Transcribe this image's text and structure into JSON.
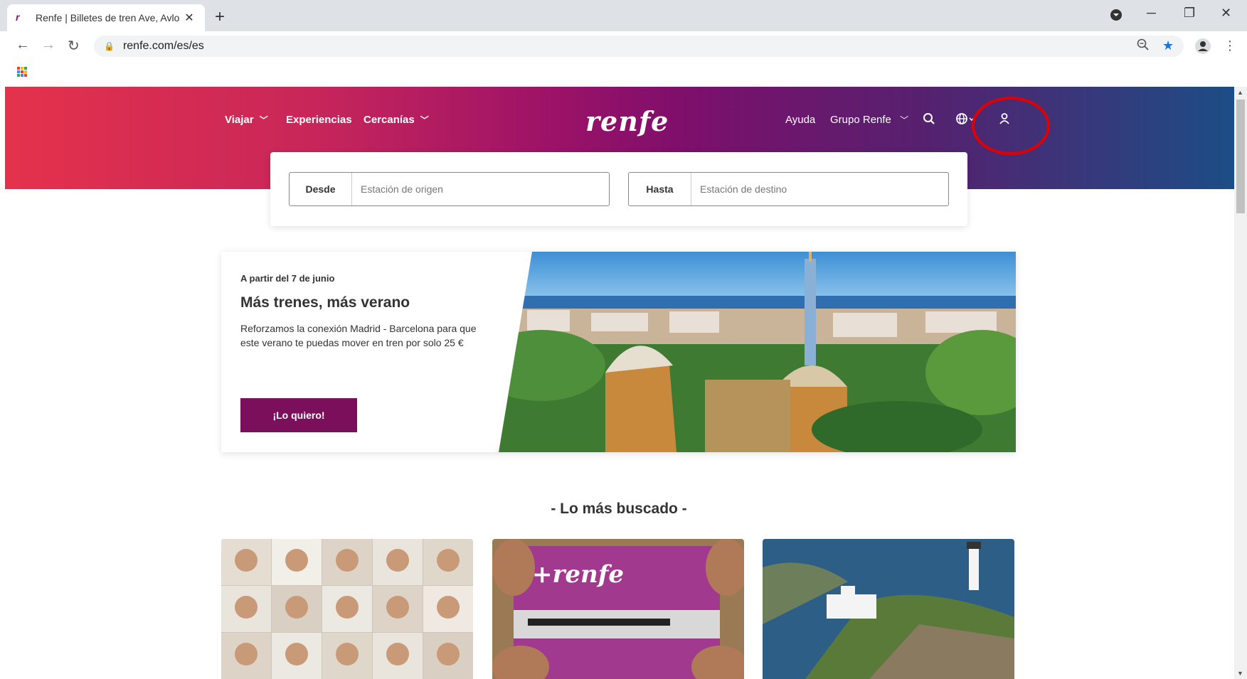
{
  "browser": {
    "tab_title": "Renfe | Billetes de tren Ave, Avlo",
    "tab_close": "✕",
    "new_tab": "+",
    "url": "renfe.com/es/es"
  },
  "header": {
    "nav_left": [
      {
        "label": "Viajar",
        "chevron": true
      },
      {
        "label": "Experiencias",
        "chevron": false
      },
      {
        "label": "Cercanías",
        "chevron": true
      }
    ],
    "logo": "renfe",
    "nav_right": [
      {
        "label": "Ayuda"
      },
      {
        "label": "Grupo Renfe"
      }
    ]
  },
  "search": {
    "from_label": "Desde",
    "from_placeholder": "Estación de origen",
    "to_label": "Hasta",
    "to_placeholder": "Estación de destino"
  },
  "promo": {
    "kicker": "A partir del 7 de junio",
    "title": "Más trenes, más verano",
    "description": "Reforzamos la conexión Madrid - Barcelona para que este verano te puedas mover en tren por solo 25 €",
    "cta": "¡Lo quiero!"
  },
  "most_searched": {
    "title": "- Lo más buscado -",
    "card_text": "+renfe"
  },
  "colors": {
    "brand_purple": "#7b0f5c",
    "highlight_red": "#e00000"
  }
}
